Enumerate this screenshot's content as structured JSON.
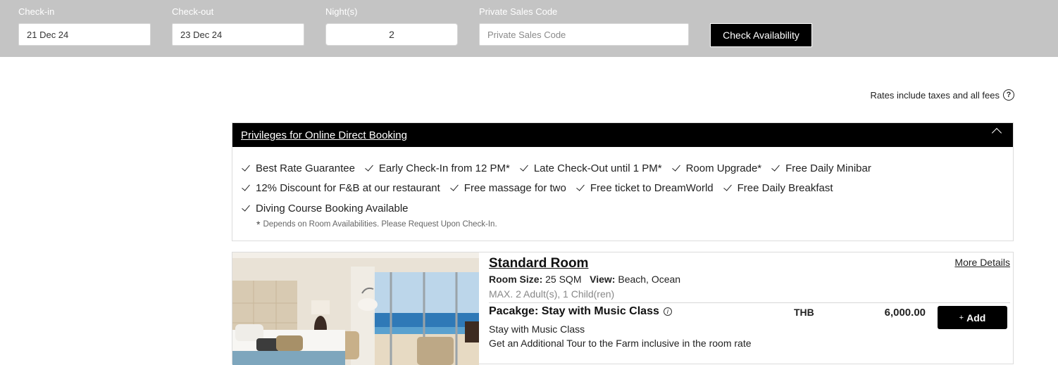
{
  "search": {
    "checkin_label": "Check-in",
    "checkin_value": "21 Dec 24",
    "checkout_label": "Check-out",
    "checkout_value": "23 Dec 24",
    "nights_label": "Night(s)",
    "nights_value": "2",
    "promo_label": "Private Sales Code",
    "promo_placeholder": "Private Sales Code",
    "check_button": "Check Availability"
  },
  "rates_note": "Rates include taxes and all fees",
  "rates_help_icon": "question-circle-icon",
  "privileges": {
    "title": "Privileges for Online Direct Booking",
    "items": [
      "Best Rate Guarantee",
      "Early Check-In from 12 PM*",
      "Late Check-Out until 1 PM*",
      "Room Upgrade*",
      "Free Daily Minibar",
      "12% Discount for F&B at our restaurant",
      "Free massage for two",
      "Free ticket to DreamWorld",
      "Free Daily Breakfast",
      "Diving Course Booking Available"
    ],
    "footnote_mark": "*",
    "footnote": "Depends on Room Availabilities. Please Request Upon Check-In."
  },
  "room": {
    "title": "Standard Room",
    "more_details": "More Details",
    "size_label": "Room Size:",
    "size_value": "25 SQM",
    "view_label": "View:",
    "view_value": "Beach, Ocean",
    "capacity": "MAX. 2 Adult(s), 1 Child(ren)",
    "package": {
      "title": "Pacakge: Stay with Music Class",
      "currency": "THB",
      "price": "6,000.00",
      "add_plus": "+",
      "add_label": "Add",
      "desc1": "Stay with Music Class",
      "desc2": "Get an Additional Tour to the Farm inclusive in the room rate"
    }
  }
}
